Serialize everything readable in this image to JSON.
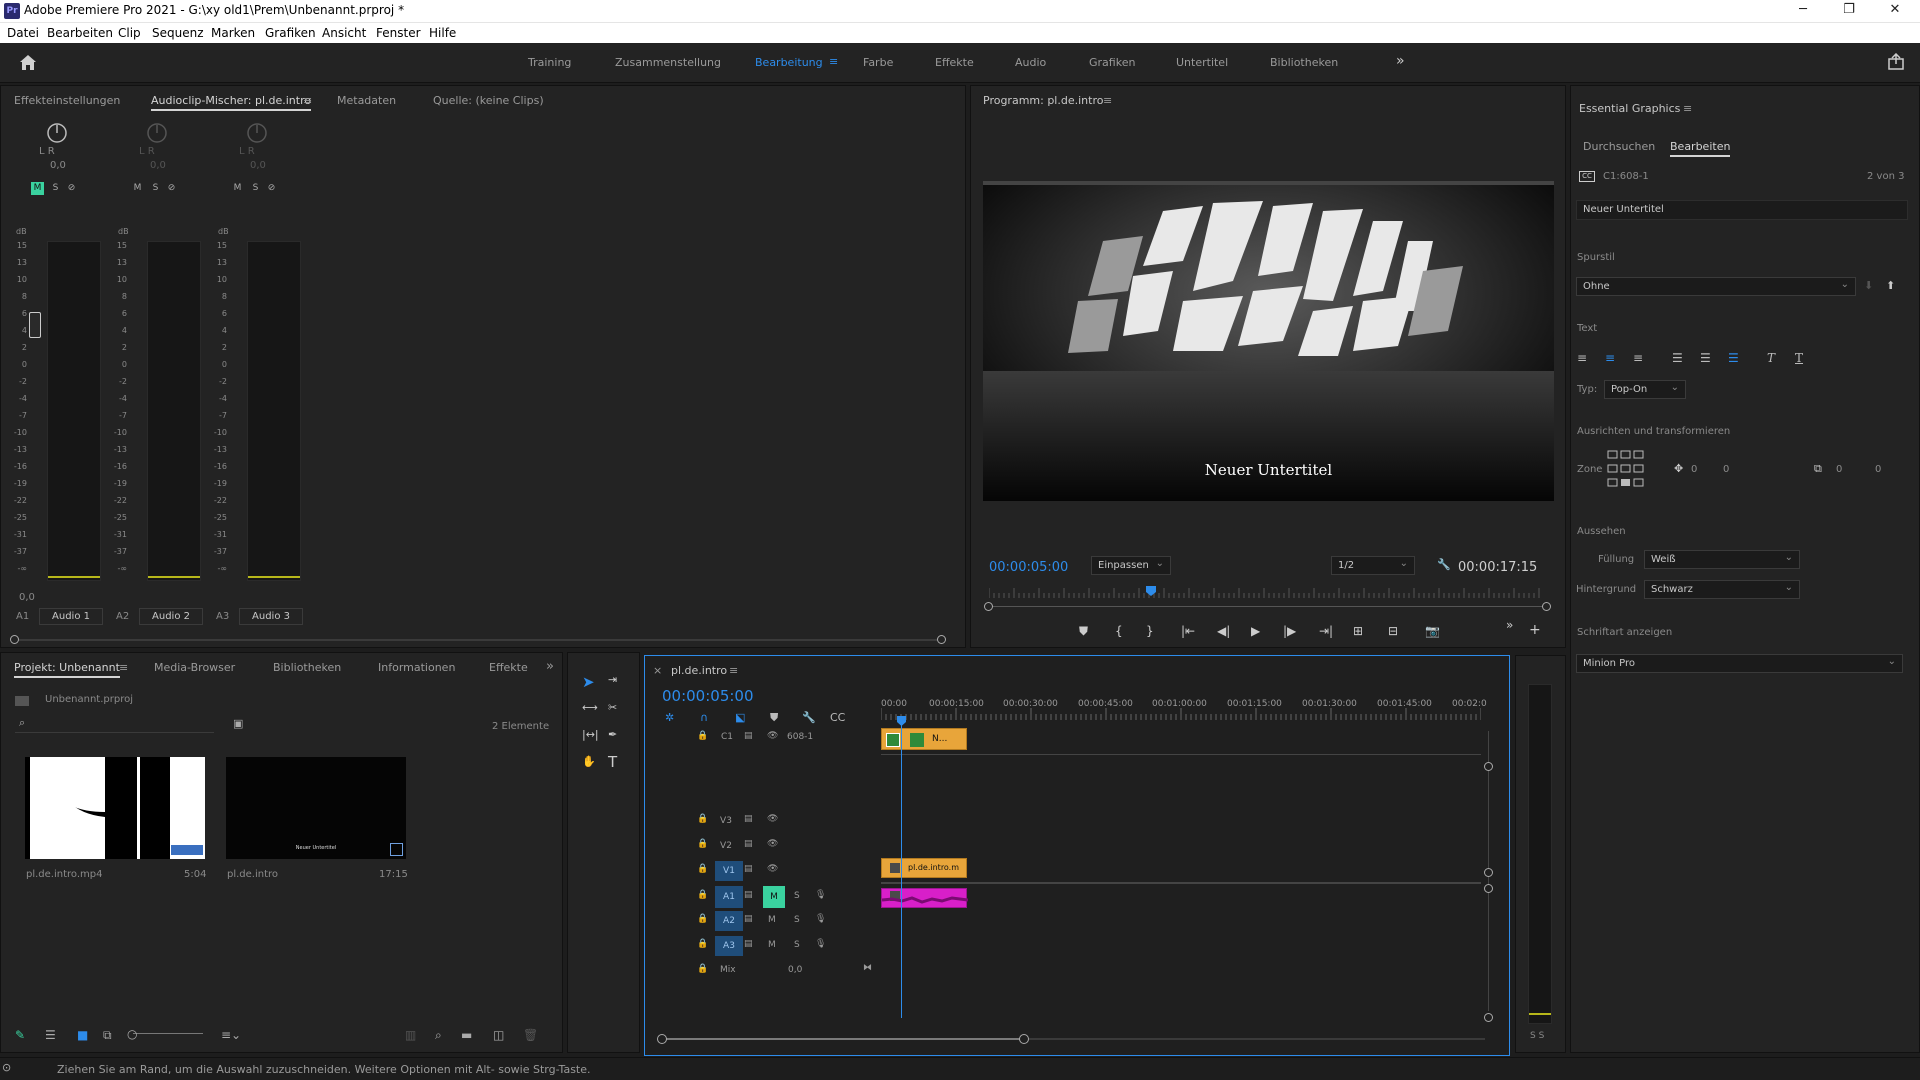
{
  "window": {
    "app_icon": "Pr",
    "title": "Adobe Premiere Pro 2021 - G:\\xy old1\\Prem\\Unbenannt.prproj *",
    "minimize_icon": "minimize-icon",
    "maximize_icon": "restore-icon",
    "close_icon": "close-icon"
  },
  "menu": [
    "Datei",
    "Bearbeiten",
    "Clip",
    "Sequenz",
    "Marken",
    "Grafiken",
    "Ansicht",
    "Fenster",
    "Hilfe"
  ],
  "workspaces": {
    "items": [
      "Training",
      "Zusammenstellung",
      "Bearbeitung",
      "Farbe",
      "Effekte",
      "Audio",
      "Grafiken",
      "Untertitel",
      "Bibliotheken"
    ],
    "active": "Bearbeitung",
    "more": "»"
  },
  "source_panel": {
    "tabs": [
      "Effekteinstellungen",
      "Audioclip-Mischer: pl.de.intro",
      "Metadaten",
      "Quelle: (keine Clips)"
    ],
    "active_tab": "Audioclip-Mischer: pl.de.intro",
    "channels": [
      {
        "lr": "L  R",
        "value": "0,0",
        "track": "A1",
        "name": "Audio 1",
        "m_active": true
      },
      {
        "lr": "L  R",
        "value": "0,0",
        "track": "A2",
        "name": "Audio 2",
        "m_active": false
      },
      {
        "lr": "L  R",
        "value": "0,0",
        "track": "A3",
        "name": "Audio 3",
        "m_active": false
      }
    ],
    "msr": [
      "M",
      "S",
      "⊘"
    ],
    "db_label": "dB",
    "db_scale": [
      "15",
      "13",
      "10",
      "8",
      "6",
      "4",
      "2",
      "0",
      "-2",
      "-4",
      "-7",
      "-10",
      "-13",
      "-16",
      "-19",
      "-22",
      "-25",
      "-31",
      "-37",
      "-∞"
    ],
    "fader_value": "0,0"
  },
  "program_monitor": {
    "title": "Programm: pl.de.intro",
    "subtitle_text": "Neuer Untertitel",
    "timecode": "00:00:05:00",
    "fit": "Einpassen",
    "resolution": "1/2",
    "duration": "00:00:17:15",
    "playhead_fraction": 0.29
  },
  "essential_graphics": {
    "title": "Essential Graphics",
    "tabs": [
      "Durchsuchen",
      "Bearbeiten"
    ],
    "active_tab": "Bearbeiten",
    "caption_id": "C1:608-1",
    "page": "2 von 3",
    "caption_text": "Neuer Untertitel",
    "track_style_label": "Spurstil",
    "track_style_value": "Ohne",
    "text_label": "Text",
    "type_label": "Typ:",
    "type_value": "Pop-On",
    "align_label": "Ausrichten und transformieren",
    "zone_label": "Zone",
    "pos_x": "0",
    "pos_y": "0",
    "size_x": "0",
    "size_y": "0",
    "appearance_label": "Aussehen",
    "fill_label": "Füllung",
    "fill_value": "Weiß",
    "bg_label": "Hintergrund",
    "bg_value": "Schwarz",
    "font_label": "Schriftart anzeigen",
    "font_value": "Minion Pro"
  },
  "project_panel": {
    "tabs": [
      "Projekt: Unbenannt",
      "Media-Browser",
      "Bibliotheken",
      "Informationen",
      "Effekte"
    ],
    "active_tab": "Projekt: Unbenannt",
    "project_file": "Unbenannt.prproj",
    "count": "2 Elemente",
    "items": [
      {
        "name": "pl.de.intro.mp4",
        "duration": "5:04"
      },
      {
        "name": "pl.de.intro",
        "duration": "17:15",
        "thumb_text": "Neuer Untertitel"
      }
    ]
  },
  "timeline": {
    "tab": "pl.de.intro",
    "timecode": "00:00:05:00",
    "ruler": [
      "00:00",
      "00:00:15:00",
      "00:00:30:00",
      "00:00:45:00",
      "00:01:00:00",
      "00:01:15:00",
      "00:01:30:00",
      "00:01:45:00",
      "00:02:0"
    ],
    "caption_track": {
      "label": "C1",
      "name": "608-1",
      "clip_label": "N..."
    },
    "video_tracks": [
      "V3",
      "V2",
      "V1"
    ],
    "audio_tracks": [
      "A1",
      "A2",
      "A3"
    ],
    "mix_label": "Mix",
    "mix_value": "0,0",
    "video_clip_label": "pl.de.intro.m",
    "meter_label": "S S"
  },
  "status_bar": {
    "text": "Ziehen Sie am Rand, um die Auswahl zuzuschneiden. Weitere Optionen mit Alt- sowie Strg-Taste."
  },
  "colors": {
    "accent_blue": "#2d8ceb",
    "caption_clip": "#e8a53a",
    "video_clip": "#e8a53a",
    "audio_clip": "#d81fc9",
    "active_mute": "#3ad29f",
    "track_target": "#1f4d7a"
  }
}
